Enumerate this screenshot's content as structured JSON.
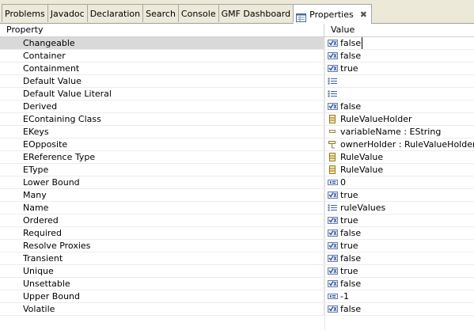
{
  "tabs": [
    {
      "label": "Problems"
    },
    {
      "label": "Javadoc"
    },
    {
      "label": "Declaration"
    },
    {
      "label": "Search"
    },
    {
      "label": "Console"
    },
    {
      "label": "GMF Dashboard"
    },
    {
      "label": "Properties",
      "active": true,
      "icon": "properties-view-icon",
      "close_icon": "close-icon"
    }
  ],
  "table": {
    "header_property": "Property",
    "header_value": "Value",
    "rows": [
      {
        "property": "Changeable",
        "value": "false",
        "icon": "boolean-icon",
        "selected": true
      },
      {
        "property": "Container",
        "value": "false",
        "icon": "boolean-icon"
      },
      {
        "property": "Containment",
        "value": "true",
        "icon": "boolean-icon"
      },
      {
        "property": "Default Value",
        "value": "",
        "icon": "list-icon"
      },
      {
        "property": "Default Value Literal",
        "value": "",
        "icon": "list-icon"
      },
      {
        "property": "Derived",
        "value": "false",
        "icon": "boolean-icon"
      },
      {
        "property": "EContaining Class",
        "value": "RuleValueHolder",
        "icon": "eclass-icon"
      },
      {
        "property": "EKeys",
        "value": "variableName : EString",
        "icon": "eattribute-icon"
      },
      {
        "property": "EOpposite",
        "value": "ownerHolder : RuleValueHolder",
        "icon": "ereference-icon"
      },
      {
        "property": "EReference Type",
        "value": "RuleValue",
        "icon": "eclass-icon"
      },
      {
        "property": "EType",
        "value": "RuleValue",
        "icon": "eclass-icon"
      },
      {
        "property": "Lower Bound",
        "value": "0",
        "icon": "number-icon"
      },
      {
        "property": "Many",
        "value": "true",
        "icon": "boolean-icon"
      },
      {
        "property": "Name",
        "value": "ruleValues",
        "icon": "list-icon"
      },
      {
        "property": "Ordered",
        "value": "true",
        "icon": "boolean-icon"
      },
      {
        "property": "Required",
        "value": "false",
        "icon": "boolean-icon"
      },
      {
        "property": "Resolve Proxies",
        "value": "true",
        "icon": "boolean-icon"
      },
      {
        "property": "Transient",
        "value": "false",
        "icon": "boolean-icon"
      },
      {
        "property": "Unique",
        "value": "true",
        "icon": "boolean-icon"
      },
      {
        "property": "Unsettable",
        "value": "false",
        "icon": "boolean-icon"
      },
      {
        "property": "Upper Bound",
        "value": "-1",
        "icon": "number-icon"
      },
      {
        "property": "Volatile",
        "value": "false",
        "icon": "boolean-icon"
      }
    ]
  }
}
